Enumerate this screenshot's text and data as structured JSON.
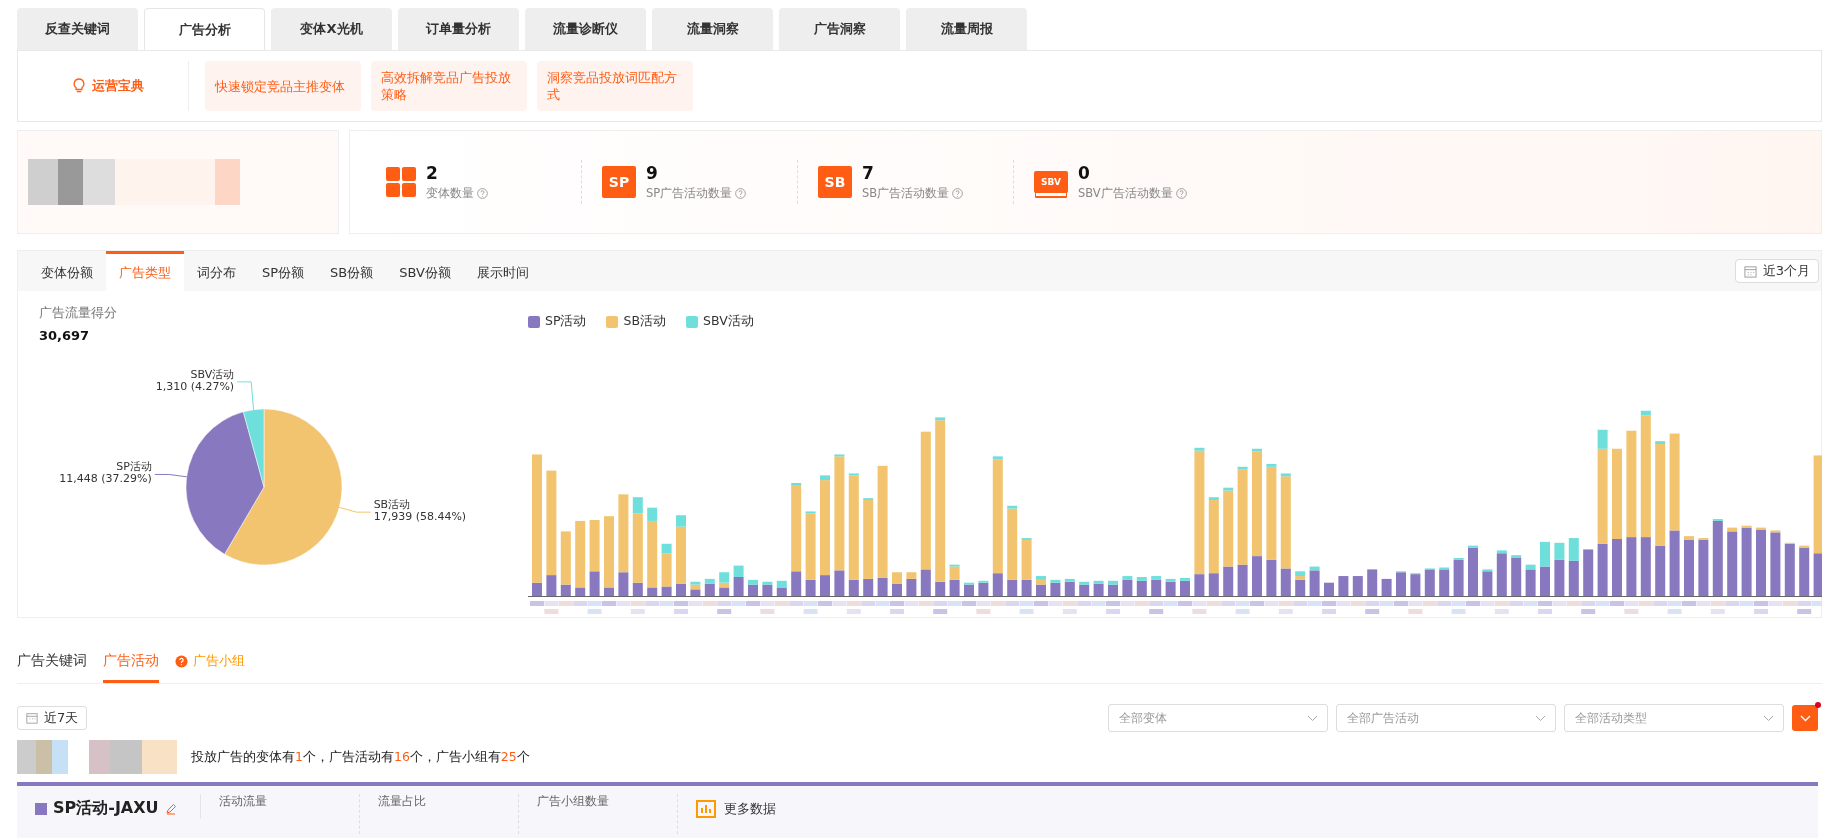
{
  "top_tabs": [
    {
      "label": "反查关键词",
      "selected": false
    },
    {
      "label": "广告分析",
      "selected": true
    },
    {
      "label": "变体X光机",
      "selected": false
    },
    {
      "label": "订单量分析",
      "selected": false
    },
    {
      "label": "流量诊断仪",
      "selected": false
    },
    {
      "label": "流量洞察",
      "selected": false
    },
    {
      "label": "广告洞察",
      "selected": false
    },
    {
      "label": "流量周报",
      "selected": false
    }
  ],
  "guide": {
    "title": "运营宝典",
    "links": [
      "快速锁定竞品主推变体",
      "高效拆解竞品广告投放策略",
      "洞察竞品投放词匹配方式"
    ]
  },
  "stats": [
    {
      "kind": "grid",
      "value": "2",
      "label": "变体数量"
    },
    {
      "kind": "badge",
      "badge": "SP",
      "value": "9",
      "label": "SP广告活动数量"
    },
    {
      "kind": "badge",
      "badge": "SB",
      "value": "7",
      "label": "SB广告活动数量"
    },
    {
      "kind": "monitor",
      "badge": "SBV",
      "value": "0",
      "label": "SBV广告活动数量"
    }
  ],
  "chart_tabs": [
    {
      "label": "变体份额",
      "selected": false
    },
    {
      "label": "广告类型",
      "selected": true
    },
    {
      "label": "词分布",
      "selected": false
    },
    {
      "label": "SP份额",
      "selected": false
    },
    {
      "label": "SB份额",
      "selected": false
    },
    {
      "label": "SBV份额",
      "selected": false
    },
    {
      "label": "展示时间",
      "selected": false
    }
  ],
  "range_button": "近3个月",
  "score": {
    "label": "广告流量得分",
    "value": "30,697"
  },
  "pie": {
    "chart_data": {
      "type": "pie",
      "categories": [
        "SB活动",
        "SP活动",
        "SBV活动"
      ],
      "values": [
        58.44,
        37.29,
        4.27
      ],
      "colors": [
        "#f2c46f",
        "#8878bf",
        "#6fdfdb"
      ],
      "value_labels": [
        "17,939 (58.44%)",
        "11,448 (37.29%)",
        "1,310 (4.27%)"
      ]
    }
  },
  "bar_legend": [
    {
      "label": "SP活动",
      "color": "#8878bf"
    },
    {
      "label": "SB活动",
      "color": "#f2c46f"
    },
    {
      "label": "SBV活动",
      "color": "#6fdfdb"
    }
  ],
  "bottom_tabs": [
    {
      "label": "广告关键词",
      "selected": false,
      "help": false
    },
    {
      "label": "广告活动",
      "selected": true,
      "help": false
    },
    {
      "label": "广告小组",
      "selected": false,
      "help": true
    }
  ],
  "date_button": "近7天",
  "filters": [
    {
      "placeholder": "全部变体"
    },
    {
      "placeholder": "全部广告活动"
    },
    {
      "placeholder": "全部活动类型"
    }
  ],
  "summary": "投放广告的变体有**1**个，广告活动有**16**个，广告小组有**25**个",
  "campaign": {
    "name": "SP活动-JAXU",
    "color": "#8878bf",
    "metrics": [
      "活动流量",
      "流量占比",
      "广告小组数量"
    ],
    "more": "更多数据"
  }
}
